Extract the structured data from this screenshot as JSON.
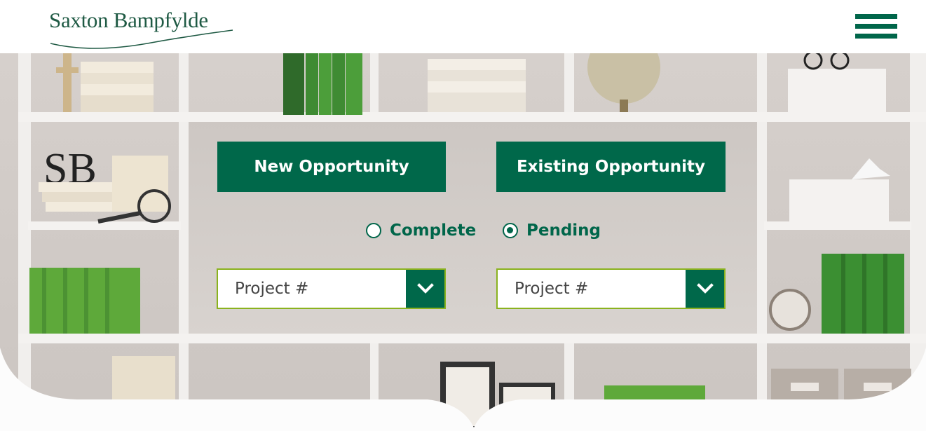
{
  "header": {
    "logo_text": "Saxton Bampfylde",
    "menu_icon": "hamburger-menu-icon"
  },
  "actions": {
    "new_opportunity": "New Opportunity",
    "existing_opportunity": "Existing Opportunity"
  },
  "status_filter": {
    "options": [
      {
        "label": "Complete",
        "selected": false
      },
      {
        "label": "Pending",
        "selected": true
      }
    ]
  },
  "project_selects": [
    {
      "placeholder": "Project #"
    },
    {
      "placeholder": "Project #"
    }
  ],
  "colors": {
    "brand_green": "#00684a",
    "select_border": "#8ab21e",
    "logo_green": "#1f5a44"
  }
}
